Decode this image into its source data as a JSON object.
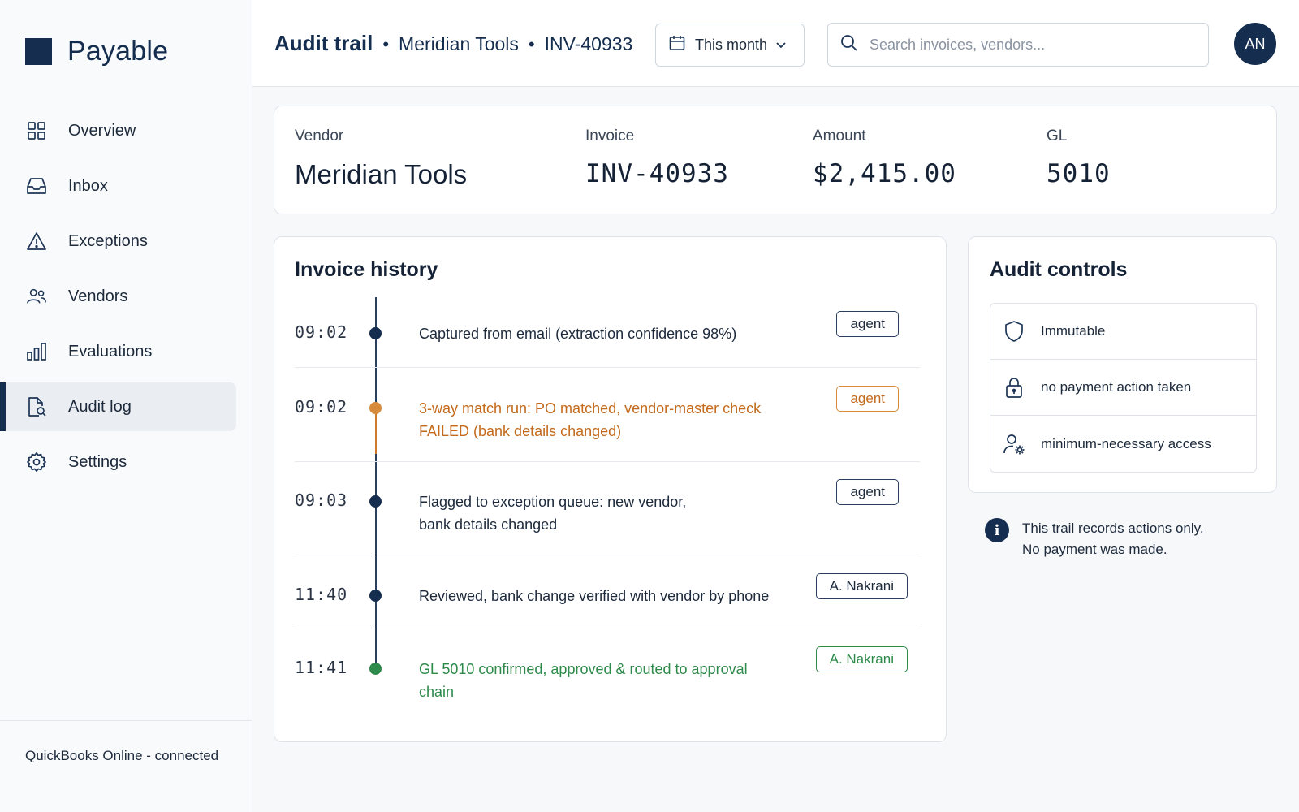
{
  "app": {
    "name": "Payable"
  },
  "sidebar": {
    "items": [
      {
        "label": "Overview",
        "icon": "grid-icon"
      },
      {
        "label": "Inbox",
        "icon": "inbox-icon"
      },
      {
        "label": "Exceptions",
        "icon": "warning-icon"
      },
      {
        "label": "Vendors",
        "icon": "users-icon"
      },
      {
        "label": "Evaluations",
        "icon": "bar-chart-icon"
      },
      {
        "label": "Audit log",
        "icon": "document-search-icon",
        "active": true
      },
      {
        "label": "Settings",
        "icon": "gear-icon"
      }
    ],
    "footer": "QuickBooks Online - connected"
  },
  "header": {
    "title": "Audit trail",
    "vendor": "Meridian Tools",
    "invoice": "INV-40933",
    "period": "This month",
    "search_placeholder": "Search invoices, vendors...",
    "avatar_initials": "AN"
  },
  "summary": {
    "vendor_label": "Vendor",
    "vendor_value": "Meridian Tools",
    "invoice_label": "Invoice",
    "invoice_value": "INV-40933",
    "amount_label": "Amount",
    "amount_value": "$2,415.00",
    "gl_label": "GL",
    "gl_value": "5010"
  },
  "history": {
    "title": "Invoice history",
    "events": [
      {
        "time": "09:02",
        "text": "Captured from email (extraction confidence 98%)",
        "actor": "agent",
        "status": "normal"
      },
      {
        "time": "09:02",
        "text": "3-way match run: PO matched, vendor-master check FAILED (bank details changed)",
        "actor": "agent",
        "status": "warning"
      },
      {
        "time": "09:03",
        "text": "Flagged to exception queue: new vendor, bank details changed",
        "actor": "agent",
        "status": "normal"
      },
      {
        "time": "11:40",
        "text": "Reviewed, bank change verified with vendor by phone",
        "actor": "A. Nakrani",
        "status": "normal"
      },
      {
        "time": "11:41",
        "text": "GL 5010 confirmed, approved & routed to approval chain",
        "actor": "A. Nakrani",
        "status": "success"
      }
    ]
  },
  "controls": {
    "title": "Audit controls",
    "items": [
      {
        "label": "Immutable",
        "icon": "shield-icon"
      },
      {
        "label": "no payment action taken",
        "icon": "lock-icon"
      },
      {
        "label": "minimum-necessary access",
        "icon": "user-settings-icon"
      }
    ]
  },
  "note": {
    "line1": "This trail records actions only.",
    "line2": "No payment was made."
  },
  "colors": {
    "brand": "#152d4e",
    "warning": "#c46a1c",
    "success": "#2e8a4a"
  }
}
